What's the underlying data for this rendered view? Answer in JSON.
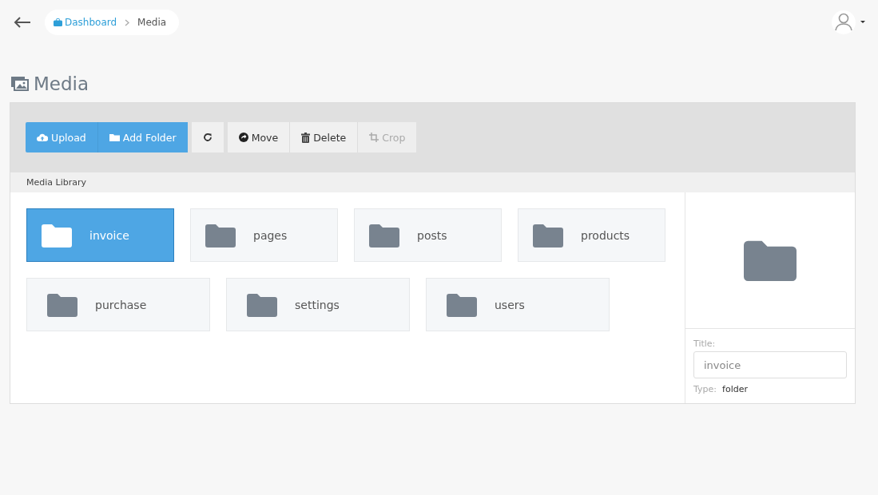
{
  "breadcrumb": [
    {
      "label": "Dashboard",
      "kind": "link"
    },
    {
      "label": "Media",
      "kind": "current"
    }
  ],
  "page_title": "Media",
  "toolbar": [
    {
      "kind": "primary",
      "buttons": [
        {
          "kind": "upload",
          "label": "Upload",
          "disabled": false
        },
        {
          "kind": "add-folder",
          "label": "Add Folder",
          "disabled": false
        }
      ]
    },
    {
      "kind": "default",
      "buttons": [
        {
          "kind": "refresh",
          "disabled": false
        }
      ]
    },
    {
      "kind": "default",
      "buttons": [
        {
          "kind": "move",
          "label": "Move",
          "disabled": false
        },
        {
          "kind": "delete",
          "label": "Delete",
          "disabled": false
        },
        {
          "kind": "crop",
          "label": "Crop",
          "disabled": true
        }
      ]
    }
  ],
  "library_label": "Media Library",
  "folder_rows": [
    [
      {
        "name": "invoice",
        "selected": true
      },
      {
        "name": "pages",
        "selected": false
      },
      {
        "name": "posts",
        "selected": false
      },
      {
        "name": "products",
        "selected": false
      }
    ],
    [
      {
        "name": "purchase",
        "selected": false
      },
      {
        "name": "settings",
        "selected": false
      },
      {
        "name": "users",
        "selected": false
      }
    ]
  ],
  "details": {
    "title_label": "Title:",
    "title_value": "invoice",
    "type_label": "Type:",
    "type_value": "folder"
  }
}
